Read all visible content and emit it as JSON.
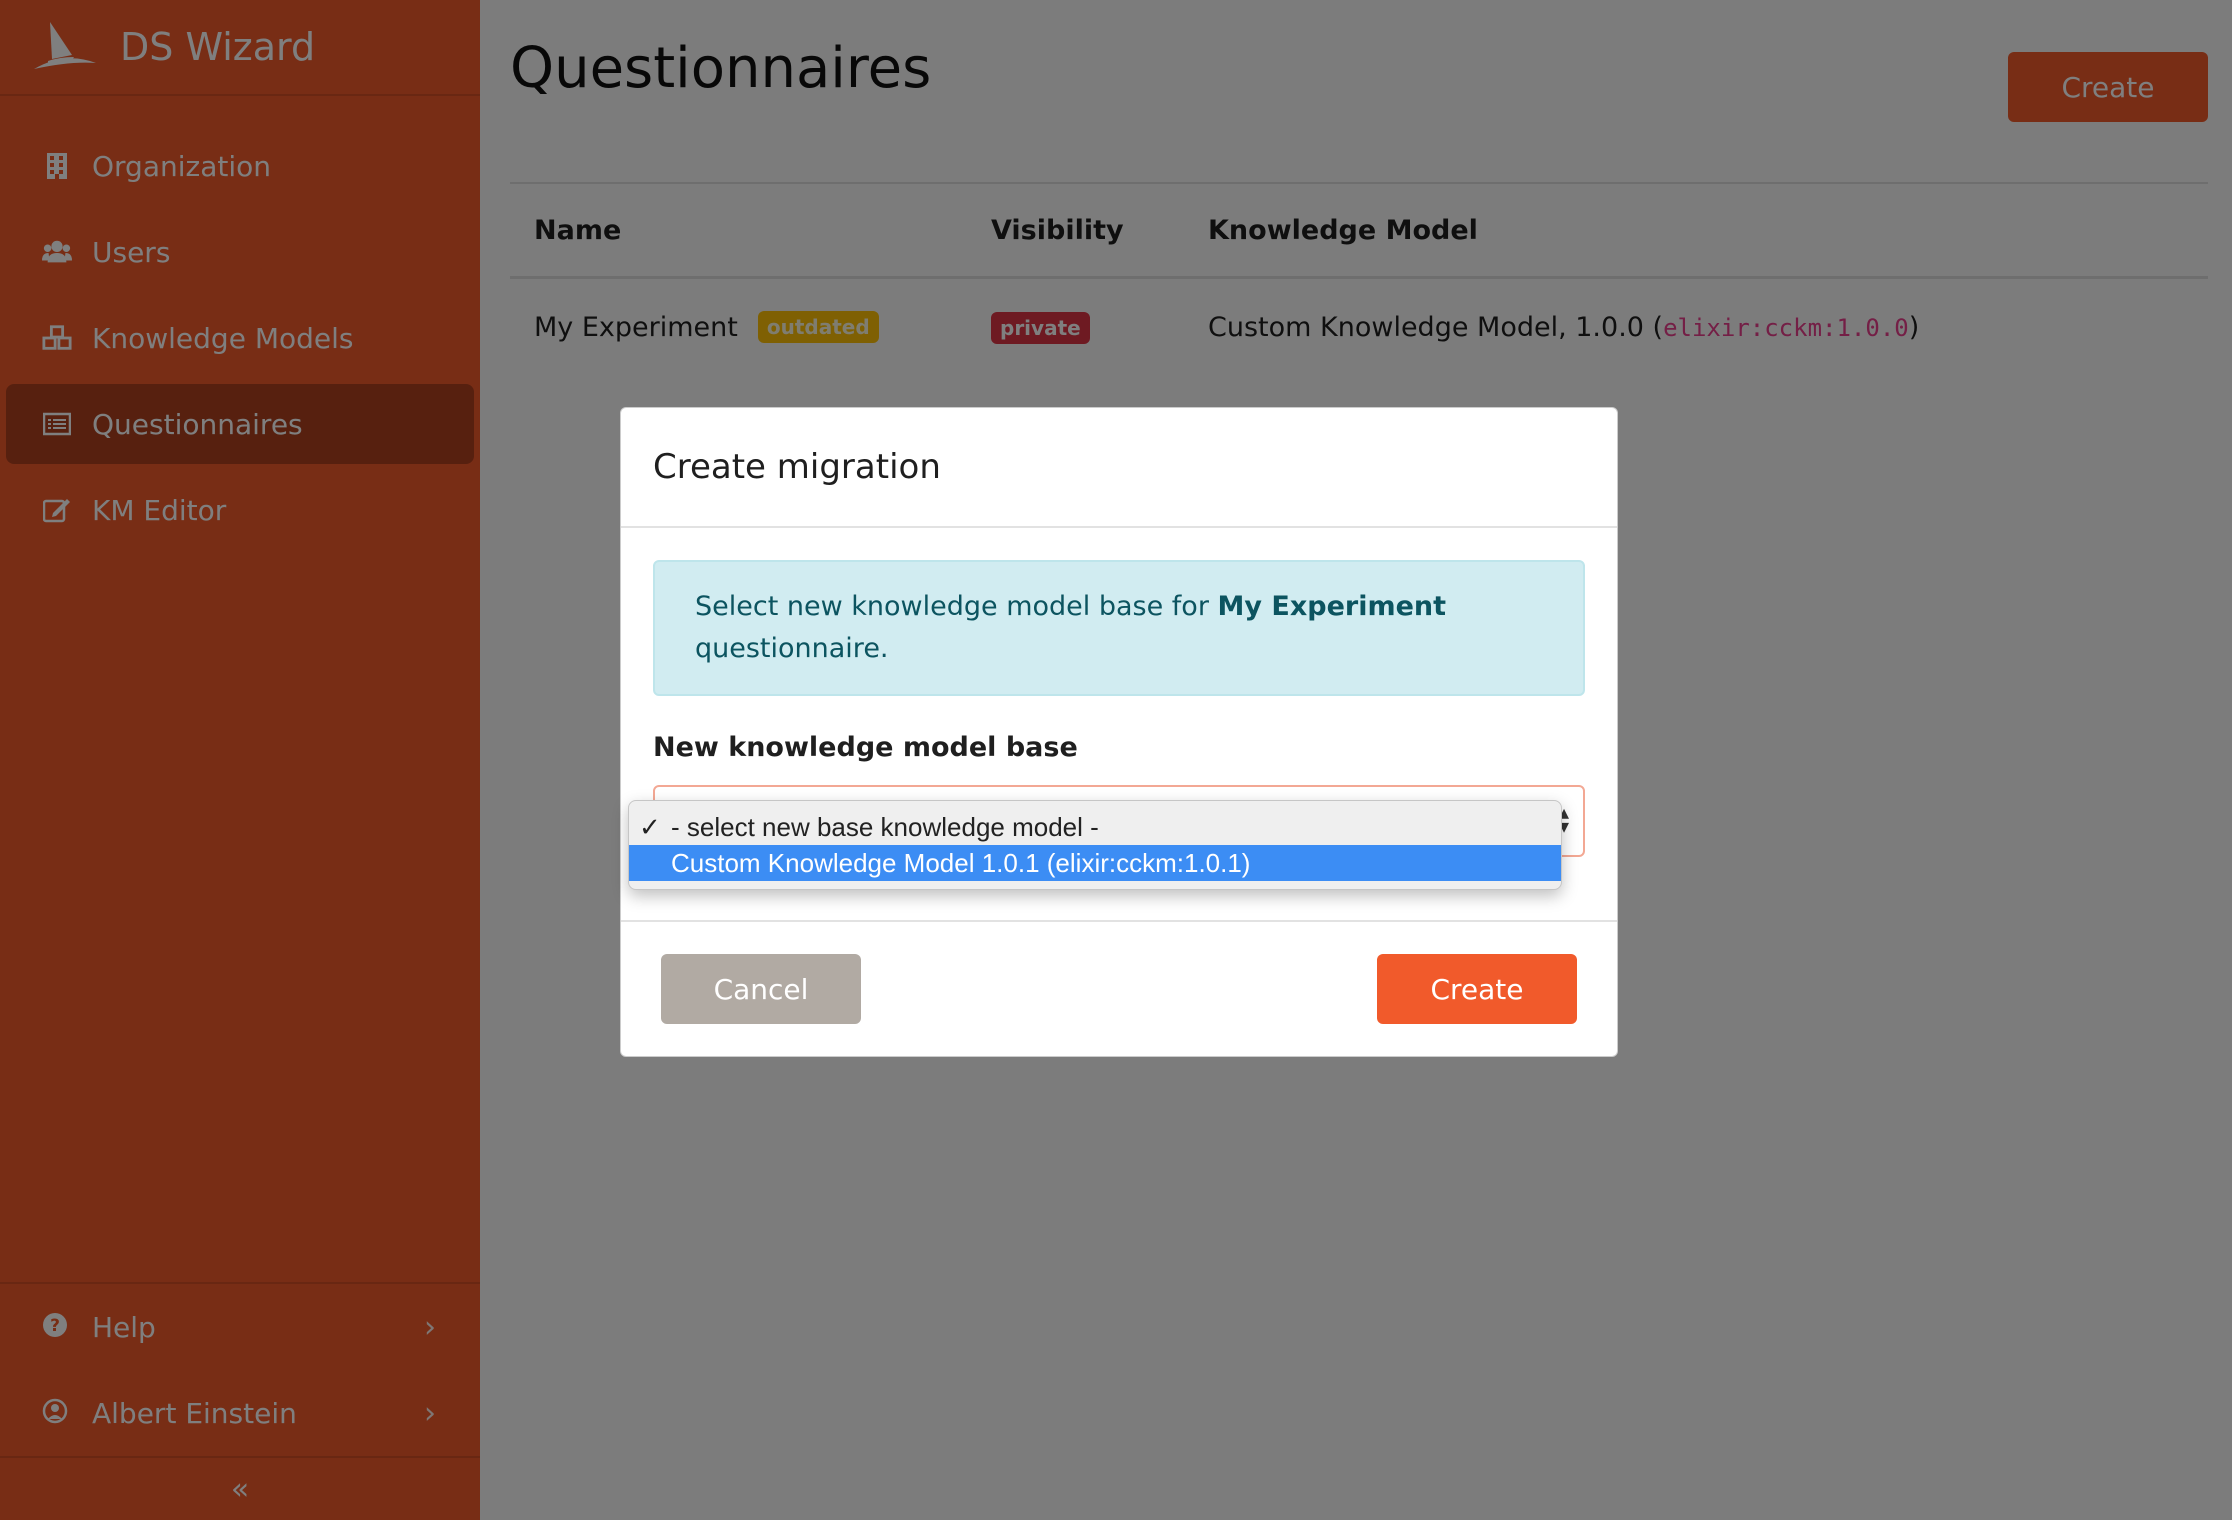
{
  "app": {
    "name": "DS Wizard"
  },
  "sidebar": {
    "items": [
      {
        "label": "Organization",
        "icon": "building-icon"
      },
      {
        "label": "Users",
        "icon": "users-icon"
      },
      {
        "label": "Knowledge Models",
        "icon": "cubes-icon"
      },
      {
        "label": "Questionnaires",
        "icon": "list-icon",
        "active": true
      },
      {
        "label": "KM Editor",
        "icon": "edit-icon"
      }
    ],
    "help_label": "Help",
    "user_label": "Albert Einstein",
    "collapse_symbol": "«"
  },
  "page": {
    "title": "Questionnaires",
    "create_label": "Create"
  },
  "table": {
    "headers": [
      "Name",
      "Visibility",
      "Knowledge Model"
    ],
    "rows": [
      {
        "name": "My Experiment",
        "status_badge": "outdated",
        "visibility": "private",
        "km_text": "Custom Knowledge Model, 1.0.0 (",
        "km_id": "elixir:cckm:1.0.0",
        "km_close": ")"
      }
    ]
  },
  "modal": {
    "title": "Create migration",
    "alert_prefix": "Select new knowledge model base for ",
    "alert_bold": "My Experiment",
    "alert_suffix": " questionnaire.",
    "field_label": "New knowledge model base",
    "cancel_label": "Cancel",
    "create_label": "Create"
  },
  "dropdown": {
    "options": [
      {
        "label": "- select new base knowledge model -",
        "checked": true
      },
      {
        "label": "Custom Knowledge Model 1.0.1 (elixir:cckm:1.0.1)",
        "highlighted": true
      }
    ]
  },
  "colors": {
    "brand": "#f15a2b",
    "alert_bg": "#d1ecf1",
    "badge_outdated": "#ffc107",
    "badge_private": "#dc3545",
    "option_highlight": "#3c8df4"
  }
}
